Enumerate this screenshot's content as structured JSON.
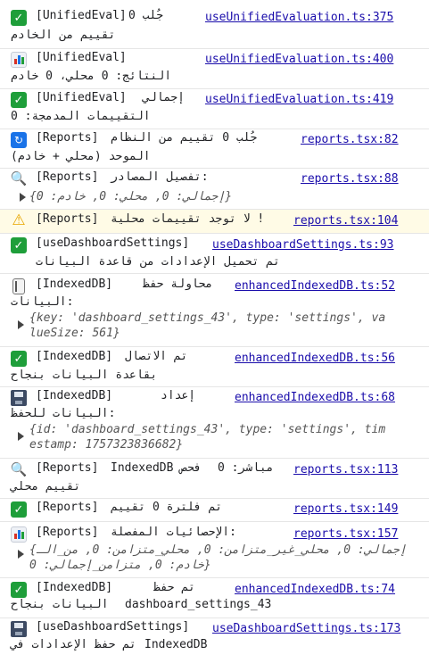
{
  "entries": [
    {
      "id": "e1",
      "tag": "[UnifiedEval]",
      "msg1": "جُلب 0",
      "msg2": "تقييم من الخادم",
      "link": "useUnifiedEvaluation.ts:375"
    },
    {
      "id": "e2",
      "tag": "[UnifiedEval]",
      "msg2": "النتائج: 0 محلي، 0 خادم",
      "link": "useUnifiedEvaluation.ts:400"
    },
    {
      "id": "e3",
      "tag": "[UnifiedEval]",
      "msg1": "إجمالي",
      "msg2": "التقييمات المدمجة: 0",
      "link": "useUnifiedEvaluation.ts:419"
    },
    {
      "id": "e4",
      "tag": "[Reports]",
      "msg1": "جُلب 0 تقييم من النظام",
      "msg2": "الموحد (محلي + خادم)",
      "link": "reports.tsx:82"
    },
    {
      "id": "e5",
      "tag": "[Reports]",
      "msg1": "تفصيل المصادر:",
      "obj": "{إجمالي: 0, محلي: 0, خادم: 0}",
      "link": "reports.tsx:88"
    },
    {
      "id": "e6",
      "tag": "[Reports]",
      "msg1": "لا توجد تقييمات محلية !",
      "link": "reports.tsx:104"
    },
    {
      "id": "e7",
      "tag": "[useDashboardSettings]",
      "msg2": "تم تحميل الإعدادات من قاعدة البيانات",
      "link": "useDashboardSettings.ts:93"
    },
    {
      "id": "e8",
      "tag": "[IndexedDB]",
      "msg1": "محاولة حفظ",
      "msg2": "البيانات:",
      "obj_l1": "{key: 'dashboard_settings_43', type: 'settings', va",
      "obj_l2": "lueSize: 561}",
      "link": "enhancedIndexedDB.ts:52"
    },
    {
      "id": "e9",
      "tag": "[IndexedDB]",
      "msg1": "تم الاتصال",
      "msg2": "بقاعدة البيانات بنجاح",
      "link": "enhancedIndexedDB.ts:56"
    },
    {
      "id": "e10",
      "tag": "[IndexedDB]",
      "msg1": "إعداد",
      "msg2": "البيانات للحفظ:",
      "obj_l1": "{id: 'dashboard_settings_43', type: 'settings', tim",
      "obj_l2": "estamp: 1757323836682}",
      "link": "enhancedIndexedDB.ts:68"
    },
    {
      "id": "e11",
      "tag": "[Reports]",
      "msg1": "IndexedDB فحص",
      "msg1b": "مباشر: 0",
      "msg2": "تقييم محلي",
      "link": "reports.tsx:113"
    },
    {
      "id": "e12",
      "tag": "[Reports]",
      "msg1": "تم فلترة 0 تقييم",
      "link": "reports.tsx:149"
    },
    {
      "id": "e13",
      "tag": "[Reports]",
      "msg1": "الإحصائيات المفصلة:",
      "obj_l1": "{إجمالي: 0, محلي_غير_متزامن: 0, محلي_متزامن: 0, من_الـ",
      "obj_l2": "خادم: 0, متزامن_إجمالي: 0}",
      "link": "reports.tsx:157"
    },
    {
      "id": "e14",
      "tag": "[IndexedDB]",
      "msg1": "تم حفظ",
      "msg2a": "dashboard_settings_43",
      "msg2b": "البيانات بنجاح",
      "link": "enhancedIndexedDB.ts:74"
    },
    {
      "id": "e15",
      "tag": "[useDashboardSettings]",
      "msg2a": "IndexedDB",
      "msg2b": "تم حفظ الإعدادات في",
      "link": "useDashboardSettings.ts:173"
    }
  ]
}
